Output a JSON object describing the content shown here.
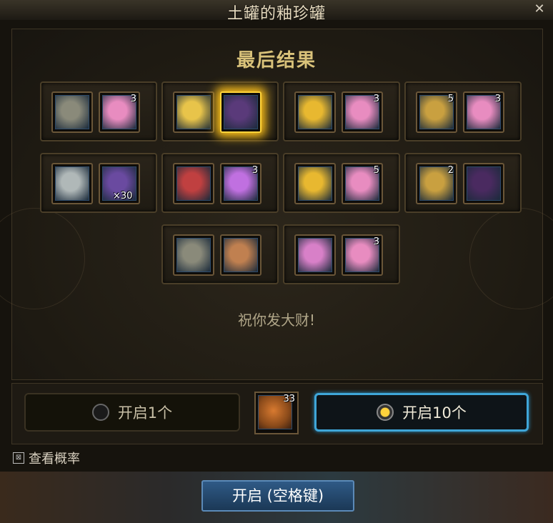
{
  "window": {
    "title": "土罐的釉珍罐",
    "close_glyph": "✕"
  },
  "results": {
    "heading": "最后结果",
    "boxes": [
      {
        "items": [
          {
            "icon": "dungeon-cube-icon",
            "color": "#8a8a7a",
            "count": ""
          },
          {
            "icon": "feather-scroll-icon",
            "color": "#e88cc0",
            "count": "3"
          }
        ]
      },
      {
        "items": [
          {
            "icon": "golden-wings-icon",
            "color": "#e8c44a",
            "count": ""
          },
          {
            "icon": "purple-orb-icon",
            "color": "#5a3a7a",
            "count": ""
          }
        ]
      },
      {
        "items": [
          {
            "icon": "golden-chest-icon",
            "color": "#e8b830",
            "count": ""
          },
          {
            "icon": "feather-scroll-icon",
            "color": "#e88cc0",
            "count": "3"
          }
        ]
      },
      {
        "items": [
          {
            "icon": "gold-coin-icon",
            "color": "#c9a040",
            "count": "5"
          },
          {
            "icon": "feather-scroll-icon",
            "color": "#e88cc0",
            "count": "3"
          }
        ]
      },
      {
        "items": [
          {
            "icon": "gray-shard-icon",
            "color": "#b0b8b8",
            "count": ""
          },
          {
            "icon": "goblin-figure-icon",
            "color": "#6a4aa0",
            "count": "×30"
          }
        ]
      },
      {
        "items": [
          {
            "icon": "color-gems-icon",
            "color": "#c04040",
            "count": ""
          },
          {
            "icon": "pink-crystal-icon",
            "color": "#c070e0",
            "count": "3"
          }
        ]
      },
      {
        "items": [
          {
            "icon": "golden-chest-icon",
            "color": "#e8b830",
            "count": ""
          },
          {
            "icon": "feather-scroll-icon",
            "color": "#e88cc0",
            "count": "5"
          }
        ]
      },
      {
        "items": [
          {
            "icon": "gold-coin-icon",
            "color": "#c9a040",
            "count": "2"
          },
          {
            "icon": "dark-portal-icon",
            "color": "#4a2a60",
            "count": ""
          }
        ]
      },
      {
        "items": [
          {
            "icon": "dungeon-cube-icon",
            "color": "#8a8a7a",
            "count": ""
          },
          {
            "icon": "warrior-portrait-icon",
            "color": "#c08050",
            "count": ""
          }
        ]
      },
      {
        "items": [
          {
            "icon": "pink-chest-icon",
            "color": "#d880c8",
            "count": ""
          },
          {
            "icon": "feather-scroll-icon",
            "color": "#e88cc0",
            "count": "3"
          }
        ]
      }
    ],
    "wish_text": "祝你发大财!"
  },
  "controls": {
    "open_one_label": "开启1个",
    "open_ten_label": "开启10个",
    "cost_item": {
      "icon": "clay-jar-icon",
      "color": "#d87a30",
      "count": "33"
    },
    "see_probability_label": "查看概率",
    "open_button_label": "开启 (空格键)"
  }
}
